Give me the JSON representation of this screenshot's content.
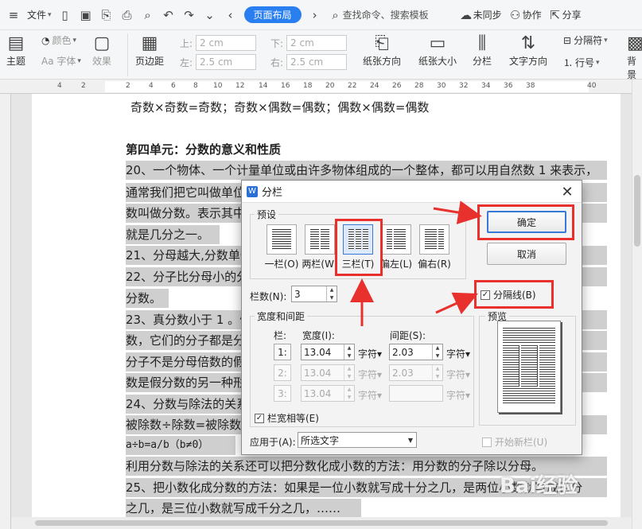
{
  "topbar": {
    "file_label": "文件",
    "page_layout_tab": "页面布局",
    "search_text": "查找命令、搜索模板",
    "unsync_label": "未同步",
    "collab_label": "协作",
    "share_label": "分享"
  },
  "ribbon": {
    "theme": "主题",
    "color": "颜色",
    "font": "Aa 字体",
    "effect": "效果",
    "margin": "页边距",
    "top_label": "上:",
    "top_value": "2 cm",
    "bottom_label": "下:",
    "bottom_value": "2 cm",
    "left_label": "左:",
    "left_value": "2.5 cm",
    "right_label": "右:",
    "right_value": "2.5 cm",
    "orientation": "纸张方向",
    "size": "纸张大小",
    "columns": "分栏",
    "text_direction": "文字方向",
    "separator": "分隔符",
    "line_number": "行号",
    "background": "背景"
  },
  "ruler": {
    "ticks": [
      "4",
      "2",
      "2",
      "4",
      "6",
      "8",
      "10",
      "12",
      "14",
      "16",
      "18",
      "20",
      "22",
      "24",
      "26",
      "28",
      "30",
      "32",
      "34",
      "36",
      "38",
      "40"
    ]
  },
  "document": {
    "lines": [
      "奇数×奇数=奇数；奇数×偶数=偶数；偶数×偶数=偶数",
      "第四单元：分数的意义和性质",
      "20、一个物体、一个计量单位或由许多物体组成的一个整体，都可以用自然数 1 来表示，",
      "通常我们把它叫做单位“",
      "数叫做分数。表示其中一",
      "就是几分之一。",
      "21、分母越大,分数单位越",
      "22、分子比分母小的分数",
      "分数。",
      "23、真分数小于 1 。假分",
      "数，它们的分子都是分母",
      "分子不是分母倍数的假分",
      "数是假分数的另一种形式",
      "24、分数与除法的关系：",
      "被除数÷除数=被除数/除",
      "a÷b=a/b（b≠0）",
      "利用分数与除法的关系还可以把分数化成小数的方法：用分数的分子除以分母。",
      "25、把小数化成分数的方法：如果是一位小数就写成十分之几，是两位小数就写成百分",
      "之几，是三位小数就写成千分之几，……"
    ]
  },
  "dialog": {
    "title": "分栏",
    "preset_legend": "预设",
    "presets": [
      {
        "label": "一栏(O)"
      },
      {
        "label": "两栏(W)"
      },
      {
        "label": "三栏(T)"
      },
      {
        "label": "偏左(L)"
      },
      {
        "label": "偏右(R)"
      }
    ],
    "ok": "确定",
    "cancel": "取消",
    "separator_line": "分隔线(B)",
    "column_count_label": "栏数(N):",
    "column_count": "3",
    "width_spacing_legend": "宽度和间距",
    "col_header": "栏:",
    "width_header": "宽度(I):",
    "spacing_header": "间距(S):",
    "unit": "字符▾",
    "rows": [
      {
        "index": "1:",
        "width": "13.04",
        "spacing": "2.03"
      },
      {
        "index": "2:",
        "width": "13.04",
        "spacing": "2.03"
      },
      {
        "index": "3:",
        "width": "13.04",
        "spacing": ""
      }
    ],
    "equal_width": "栏宽相等(E)",
    "apply_to_label": "应用于(A):",
    "apply_to_value": "所选文字",
    "preview_legend": "预览",
    "new_column": "开始新栏(U)"
  },
  "watermark": "Bai经验"
}
